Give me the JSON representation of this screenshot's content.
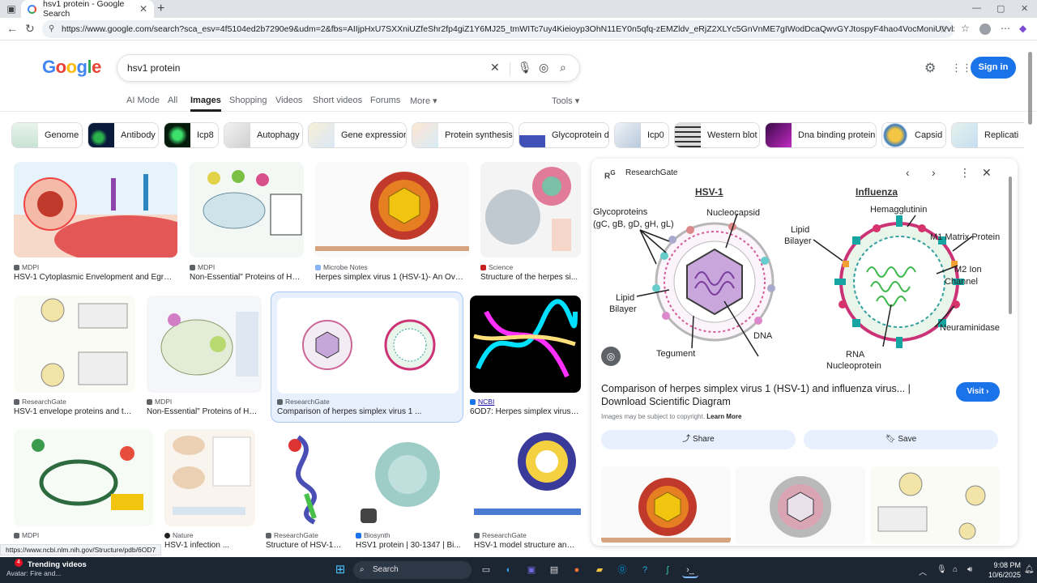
{
  "browser": {
    "tab_title": "hsv1 protein - Google Search",
    "url": "https://www.google.com/search?sca_esv=4f5104ed2b7290e9&udm=2&fbs=AIIjpHxU7SXXniUZfeShr2fp4giZ1Y6MJ25_tmWITc7uy4Kieioyp3OhN11EY0n5qfq-zEMZldv_eRjZ2XLYc5GnVnME7gIWodDcaQwvGYJtospyF4hao4VocMoniUVvlzzwRcCLYvfsjPeiuln4CZ9mx..."
  },
  "google": {
    "logo": "Google",
    "query": "hsv1 protein",
    "sign_in": "Sign in",
    "tabs": [
      "AI Mode",
      "All",
      "Images",
      "Shopping",
      "Videos",
      "Short videos",
      "Forums",
      "More"
    ],
    "active_tab": "Images",
    "tools": "Tools"
  },
  "chips": [
    "Genome",
    "Antibody",
    "Icp8",
    "Autophagy",
    "Gene expression",
    "Protein synthesis",
    "Glycoprotein d",
    "Icp0",
    "Western blot",
    "Dna binding protein",
    "Capsid",
    "Replicati"
  ],
  "results": [
    {
      "source": "MDPI",
      "title": "HSV-1 Cytoplasmic Envelopment and Egress"
    },
    {
      "source": "MDPI",
      "title": "Non-Essential\" Proteins of HS..."
    },
    {
      "source": "Microbe Notes",
      "title": "Herpes simplex virus 1 (HSV-1)- An Overvi..."
    },
    {
      "source": "Science",
      "title": "Structure of the herpes si..."
    },
    {
      "source": "ResearchGate",
      "title": "HSV-1 envelope proteins and the..."
    },
    {
      "source": "MDPI",
      "title": "Non-Essential\" Proteins of HSV..."
    },
    {
      "source": "ResearchGate",
      "title": "Comparison of herpes simplex virus 1 ..."
    },
    {
      "source": "NCBI",
      "title": "6OD7: Herpes simplex virus t..."
    },
    {
      "source": "MDPI",
      "title": "HSV-1 Essential Proteins of HSV-1 ..."
    },
    {
      "source": "Nature",
      "title": "HSV-1 infection ..."
    },
    {
      "source": "ResearchGate",
      "title": "Structure of HSV-1 r..."
    },
    {
      "source": "Biosynth",
      "title": "HSV1 protein | 30-1347 | Bi..."
    },
    {
      "source": "ResearchGate",
      "title": "HSV-1 model structure and g..."
    }
  ],
  "panel": {
    "site": "ResearchGate",
    "title": "Comparison of herpes simplex virus 1 (HSV-1) and influenza virus... | Download Scientific Diagram",
    "visit": "Visit",
    "copyright": "Images may be subject to copyright.",
    "learn_more": "Learn More",
    "share": "Share",
    "save": "Save",
    "diagram": {
      "left_title": "HSV-1",
      "right_title": "Influenza",
      "labels_left": [
        "Glycoproteins",
        "(gC, gB, gD, gH, gL)",
        "Nucleocapsid",
        "Lipid",
        "Bilayer",
        "Tegument",
        "DNA"
      ],
      "labels_right": [
        "Hemagglutinin",
        "Lipid",
        "Bilayer",
        "M1 Matrix Protein",
        "M2 Ion",
        "Channel",
        "Neuraminidase",
        "RNA",
        "Nucleoprotein"
      ]
    }
  },
  "status_url": "https://www.ncbi.nlm.nih.gov/Structure/pdb/6OD7",
  "taskbar": {
    "news_title": "Trending videos",
    "news_sub": "Avatar: Fire and...",
    "badge": "4",
    "search": "Search",
    "time": "9:08 PM",
    "date": "10/6/2025"
  },
  "colors": {
    "accent": "#1a73e8",
    "selected_bg": "#e8f0fe"
  }
}
